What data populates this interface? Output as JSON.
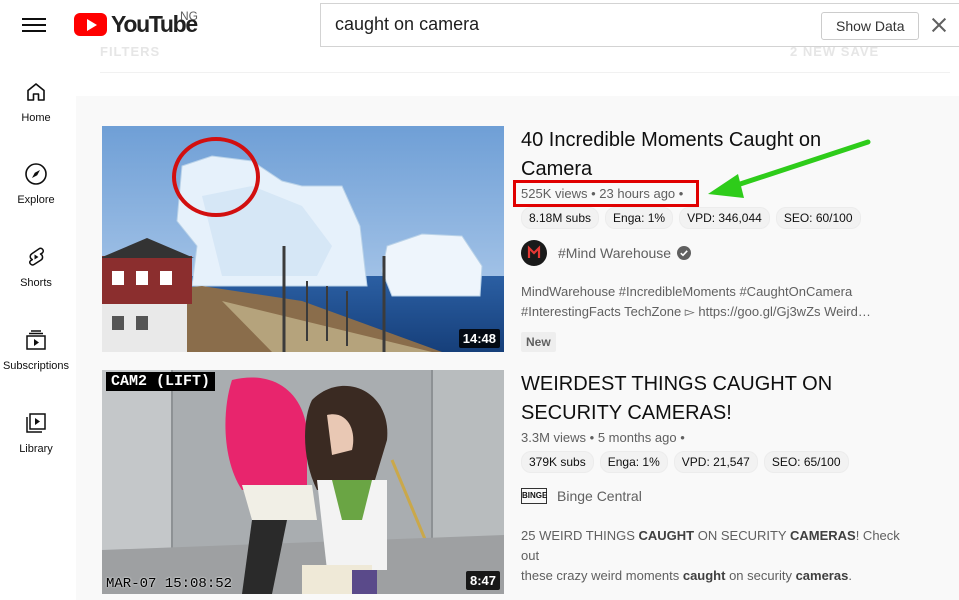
{
  "header": {
    "logo_text": "YouTube",
    "region": "NG",
    "search_value": "caught on camera",
    "show_data_label": "Show Data",
    "filters_label": "FILTERS",
    "right_ghost_label": "2 NEW SAVE"
  },
  "sidebar": {
    "items": [
      {
        "label": "Home",
        "icon": "home-icon"
      },
      {
        "label": "Explore",
        "icon": "compass-icon"
      },
      {
        "label": "Shorts",
        "icon": "shorts-icon"
      },
      {
        "label": "Subscriptions",
        "icon": "subscriptions-icon"
      },
      {
        "label": "Library",
        "icon": "library-icon"
      }
    ]
  },
  "videos": [
    {
      "title": "40 Incredible Moments Caught on Camera",
      "views": "525K views",
      "age": "23 hours ago",
      "stats": [
        "8.18M subs",
        "Enga: 1%",
        "VPD: 346,044",
        "SEO: 60/100"
      ],
      "channel": "#Mind Warehouse",
      "verified": true,
      "description_line1": "MindWarehouse #IncredibleMoments #CaughtOnCamera",
      "description_line2": "#InterestingFacts TechZone ▻ https://goo.gl/Gj3wZs Weird…",
      "badge": "New",
      "duration": "14:48"
    },
    {
      "title": "WEIRDEST THINGS CAUGHT ON SECURITY CAMERAS!",
      "views": "3.3M views",
      "age": "5 months ago",
      "stats": [
        "379K subs",
        "Enga: 1%",
        "VPD: 21,547",
        "SEO: 65/100"
      ],
      "channel": "Binge Central",
      "channel_avatar_text": "BINGE",
      "description_line1_parts": [
        "25 WEIRD THINGS ",
        "CAUGHT",
        " ON SECURITY ",
        "CAMERAS",
        "! Check out"
      ],
      "description_line2_parts": [
        "these crazy weird moments ",
        "caught",
        " on security ",
        "cameras",
        "."
      ],
      "duration": "8:47",
      "cam_label": "CAM2 (LIFT)",
      "cam_timestamp": "MAR-07 15:08:52"
    }
  ],
  "colors": {
    "annotation_red": "#e00000",
    "annotation_green": "#2ecc1a",
    "youtube_red": "#ff0000"
  }
}
